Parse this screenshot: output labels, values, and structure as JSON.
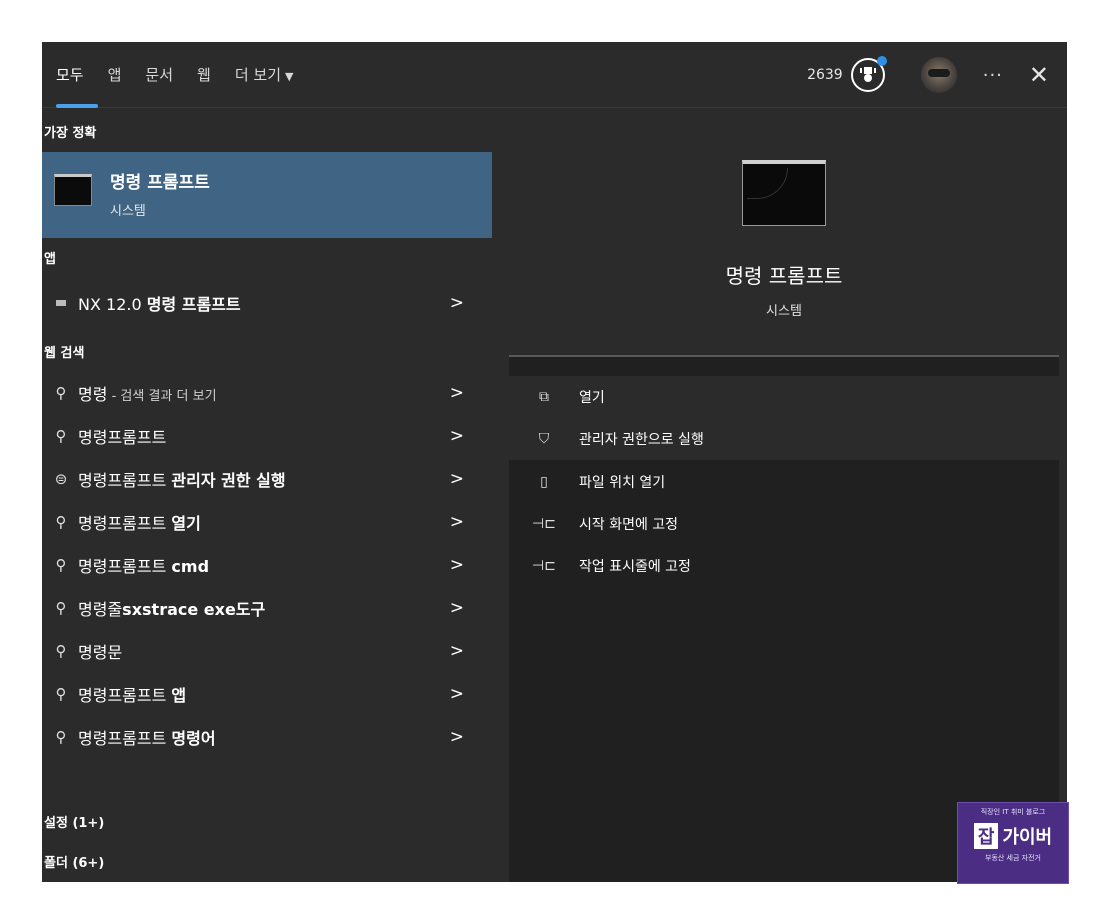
{
  "header": {
    "tabs": [
      {
        "label": "모두",
        "active": true
      },
      {
        "label": "앱",
        "active": false
      },
      {
        "label": "문서",
        "active": false
      },
      {
        "label": "웹",
        "active": false
      },
      {
        "label": "더 보기",
        "active": false
      }
    ],
    "score": "2639"
  },
  "best_match": {
    "section": "가장 정확",
    "title": "명령 프롬프트",
    "subtitle": "시스템"
  },
  "apps": {
    "section": "앱",
    "items": [
      {
        "prefix": "NX 12.0 ",
        "label": "명령 프롬프트"
      }
    ]
  },
  "web": {
    "section": "웹 검색",
    "first": {
      "label": "명령",
      "suffix": " - 검색 결과 더 보기"
    },
    "items": [
      {
        "label": "명령프롬프트",
        "bold": "",
        "icon": "search-icon"
      },
      {
        "label": "명령프롬프트 ",
        "bold": "관리자 권한 실행",
        "icon": "chat-icon"
      },
      {
        "label": "명령프롬프트 ",
        "bold": "열기",
        "icon": "search-icon"
      },
      {
        "label": "명령프롬프트 ",
        "bold": "cmd",
        "icon": "search-icon"
      },
      {
        "label": "명령줄",
        "bold": "sxstrace exe도구",
        "icon": "search-icon"
      },
      {
        "label": "명령문",
        "bold": "",
        "icon": "search-icon"
      },
      {
        "label": "명령프롬프트 ",
        "bold": "앱",
        "icon": "search-icon"
      },
      {
        "label": "명령프롬프트 ",
        "bold": "명령어",
        "icon": "search-icon"
      }
    ]
  },
  "settings": {
    "section": "설정 (1+)"
  },
  "folders": {
    "section": "폴더 (6+)"
  },
  "preview": {
    "title": "명령 프롬프트",
    "subtitle": "시스템",
    "actions": [
      {
        "label": "열기",
        "icon": "open-icon"
      },
      {
        "label": "관리자 권한으로 실행",
        "icon": "shield-icon"
      },
      {
        "label": "파일 위치 열기",
        "icon": "file-location-icon"
      },
      {
        "label": "시작 화면에 고정",
        "icon": "pin-icon"
      },
      {
        "label": "작업 표시줄에 고정",
        "icon": "pin-icon"
      }
    ]
  },
  "watermark": {
    "top": "직장인 IT 취미 블로그",
    "brand_a": "잡",
    "brand_b": "가이버",
    "bottom": "부동산 세금 자전거"
  },
  "colors": {
    "panel": "#2b2b2b",
    "accent": "#4aa0ea",
    "selected": "#3f6484",
    "preview_bg": "#202020"
  }
}
